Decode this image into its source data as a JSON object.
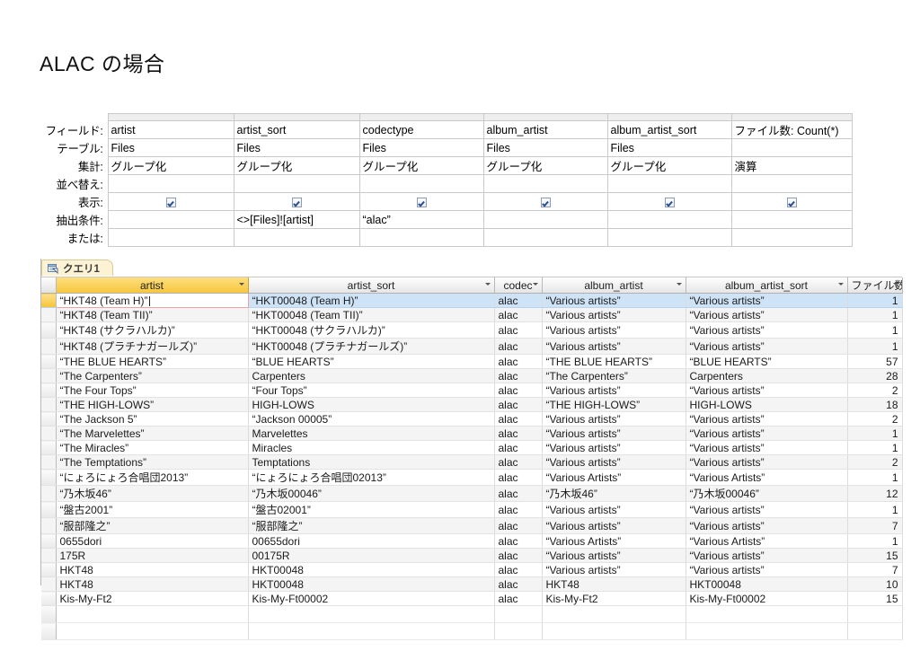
{
  "slide": {
    "title": "ALAC の場合"
  },
  "design_grid": {
    "row_labels": [
      "フィールド:",
      "テーブル:",
      "集計:",
      "並べ替え:",
      "表示:",
      "抽出条件:",
      "または:"
    ],
    "columns": [
      {
        "field": "artist",
        "table": "Files",
        "total": "グループ化",
        "sort": "",
        "show": true,
        "criteria": "",
        "or": ""
      },
      {
        "field": "artist_sort",
        "table": "Files",
        "total": "グループ化",
        "sort": "",
        "show": true,
        "criteria": "<>[Files]![artist]",
        "or": ""
      },
      {
        "field": "codectype",
        "table": "Files",
        "total": "グループ化",
        "sort": "",
        "show": true,
        "criteria": "“alac”",
        "or": ""
      },
      {
        "field": "album_artist",
        "table": "Files",
        "total": "グループ化",
        "sort": "",
        "show": true,
        "criteria": "",
        "or": ""
      },
      {
        "field": "album_artist_sort",
        "table": "Files",
        "total": "グループ化",
        "sort": "",
        "show": true,
        "criteria": "",
        "or": ""
      },
      {
        "field": "ファイル数: Count(*)",
        "table": "",
        "total": "演算",
        "sort": "",
        "show": true,
        "criteria": "",
        "or": ""
      }
    ]
  },
  "datasheet": {
    "tab_label": "クエリ1",
    "tab_icon": "query-icon",
    "columns": [
      {
        "label": "artist",
        "selected": true
      },
      {
        "label": "artist_sort",
        "selected": false
      },
      {
        "label": "codec",
        "selected": false
      },
      {
        "label": "album_artist",
        "selected": false
      },
      {
        "label": "album_artist_sort",
        "selected": false
      },
      {
        "label": "ファイル数",
        "selected": false
      }
    ],
    "rows": [
      {
        "artist": "“HKT48 (Team H)”",
        "artist_sort": "“HKT00048 (Team H)”",
        "codec": "alac",
        "album_artist": "“Various artists”",
        "album_artist_sort": "“Various artists”",
        "count": "1"
      },
      {
        "artist": "“HKT48 (Team TII)”",
        "artist_sort": "“HKT00048 (Team TII)”",
        "codec": "alac",
        "album_artist": "“Various artists”",
        "album_artist_sort": "“Various artists”",
        "count": "1"
      },
      {
        "artist": "“HKT48 (サクラハルカ)”",
        "artist_sort": "“HKT00048 (サクラハルカ)”",
        "codec": "alac",
        "album_artist": "“Various artists”",
        "album_artist_sort": "“Various artists”",
        "count": "1"
      },
      {
        "artist": "“HKT48 (プラチナガールズ)”",
        "artist_sort": "“HKT00048 (プラチナガールズ)”",
        "codec": "alac",
        "album_artist": "“Various artists”",
        "album_artist_sort": "“Various artists”",
        "count": "1"
      },
      {
        "artist": "“THE BLUE HEARTS”",
        "artist_sort": "“BLUE HEARTS”",
        "codec": "alac",
        "album_artist": "“THE BLUE HEARTS”",
        "album_artist_sort": "“BLUE HEARTS”",
        "count": "57"
      },
      {
        "artist": "“The Carpenters”",
        "artist_sort": "Carpenters",
        "codec": "alac",
        "album_artist": "“The Carpenters”",
        "album_artist_sort": "Carpenters",
        "count": "28"
      },
      {
        "artist": "“The Four Tops”",
        "artist_sort": "“Four Tops”",
        "codec": "alac",
        "album_artist": "“Various artists”",
        "album_artist_sort": "“Various artists”",
        "count": "2"
      },
      {
        "artist": "“THE HIGH-LOWS”",
        "artist_sort": "HIGH-LOWS",
        "codec": "alac",
        "album_artist": "“THE HIGH-LOWS”",
        "album_artist_sort": "HIGH-LOWS",
        "count": "18"
      },
      {
        "artist": "“The Jackson 5”",
        "artist_sort": "“Jackson 00005”",
        "codec": "alac",
        "album_artist": "“Various artists”",
        "album_artist_sort": "“Various artists”",
        "count": "2"
      },
      {
        "artist": "“The Marvelettes”",
        "artist_sort": "Marvelettes",
        "codec": "alac",
        "album_artist": "“Various artists”",
        "album_artist_sort": "“Various artists”",
        "count": "1"
      },
      {
        "artist": "“The Miracles”",
        "artist_sort": "Miracles",
        "codec": "alac",
        "album_artist": "“Various artists”",
        "album_artist_sort": "“Various artists”",
        "count": "1"
      },
      {
        "artist": "“The Temptations”",
        "artist_sort": "Temptations",
        "codec": "alac",
        "album_artist": "“Various artists”",
        "album_artist_sort": "“Various artists”",
        "count": "2"
      },
      {
        "artist": "“にょろにょろ合唱団2013”",
        "artist_sort": "“にょろにょろ合唱団02013”",
        "codec": "alac",
        "album_artist": "“Various Artists”",
        "album_artist_sort": "“Various Artists”",
        "count": "1"
      },
      {
        "artist": "“乃木坂46”",
        "artist_sort": "“乃木坂00046”",
        "codec": "alac",
        "album_artist": "“乃木坂46”",
        "album_artist_sort": "“乃木坂00046”",
        "count": "12"
      },
      {
        "artist": "“盤古2001”",
        "artist_sort": "“盤古02001”",
        "codec": "alac",
        "album_artist": "“Various artists”",
        "album_artist_sort": "“Various artists”",
        "count": "1"
      },
      {
        "artist": "“服部隆之”",
        "artist_sort": "“服部隆之”",
        "codec": "alac",
        "album_artist": "“Various artists”",
        "album_artist_sort": "“Various artists”",
        "count": "7"
      },
      {
        "artist": "0655dori",
        "artist_sort": "00655dori",
        "codec": "alac",
        "album_artist": "“Various Artists”",
        "album_artist_sort": "“Various Artists”",
        "count": "1"
      },
      {
        "artist": "175R",
        "artist_sort": "00175R",
        "codec": "alac",
        "album_artist": "“Various artists”",
        "album_artist_sort": "“Various artists”",
        "count": "15"
      },
      {
        "artist": "HKT48",
        "artist_sort": "HKT00048",
        "codec": "alac",
        "album_artist": "“Various artists”",
        "album_artist_sort": "“Various artists”",
        "count": "7"
      },
      {
        "artist": "HKT48",
        "artist_sort": "HKT00048",
        "codec": "alac",
        "album_artist": "HKT48",
        "album_artist_sort": "HKT00048",
        "count": "10"
      },
      {
        "artist": "Kis-My-Ft2",
        "artist_sort": "Kis-My-Ft00002",
        "codec": "alac",
        "album_artist": "Kis-My-Ft2",
        "album_artist_sort": "Kis-My-Ft00002",
        "count": "15"
      }
    ],
    "selected_row_index": 0,
    "editing_cell": "artist"
  },
  "colors": {
    "selection_blue": "#cfe3f7",
    "selected_column_header": "#f6c63f",
    "tab_background": "#fdf2d3",
    "grid_line": "#dcdcdc"
  }
}
